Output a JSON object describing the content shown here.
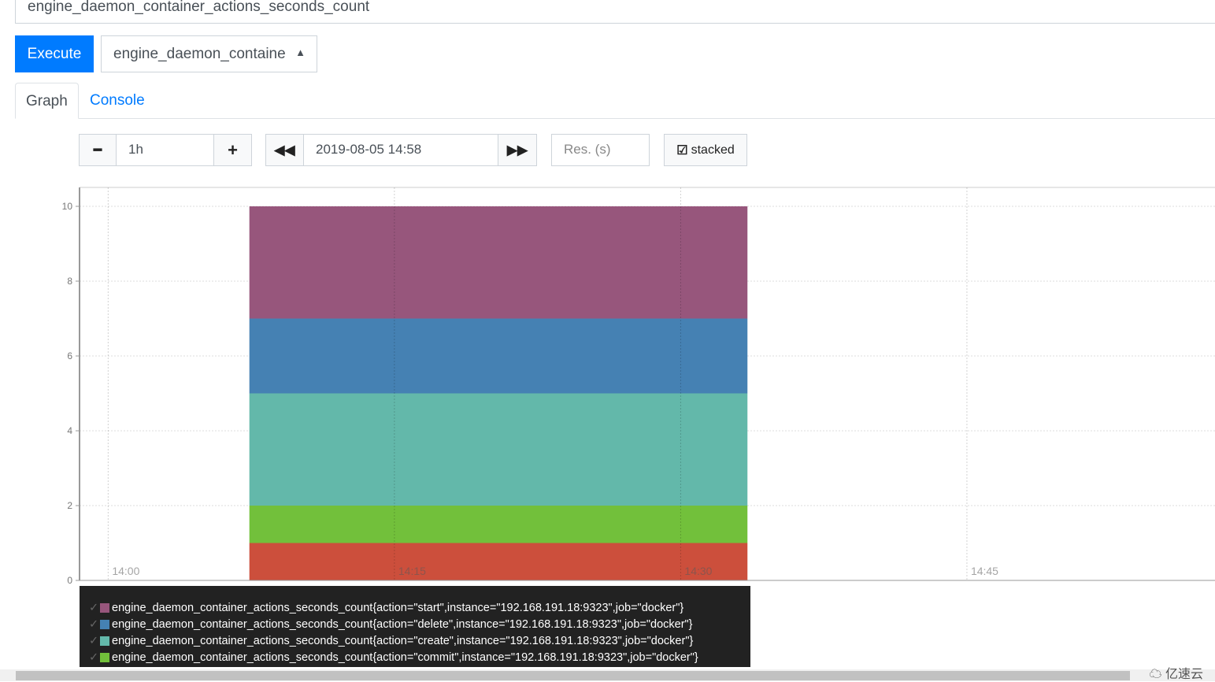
{
  "query": {
    "value": "engine_daemon_container_actions_seconds_count"
  },
  "execute_label": "Execute",
  "metric_select": {
    "selected": "engine_daemon_containe"
  },
  "tabs": [
    {
      "label": "Graph",
      "active": true
    },
    {
      "label": "Console",
      "active": false
    }
  ],
  "controls": {
    "range": "1h",
    "end_time": "2019-08-05 14:58",
    "res_placeholder": "Res. (s)",
    "stacked_label": "stacked",
    "stacked": true
  },
  "watermark": "亿速云",
  "chart_data": {
    "type": "area",
    "stacked": true,
    "x_ticks": [
      "14:00",
      "14:15",
      "14:30",
      "14:45"
    ],
    "y_ticks": [
      0,
      2,
      4,
      6,
      8,
      10
    ],
    "ylim": [
      0,
      10
    ],
    "x_range": [
      "13:58:30",
      "14:58"
    ],
    "data_start": "14:07:24",
    "data_end": "14:33:30",
    "series": [
      {
        "name": "",
        "value": 1,
        "color": "#cc4f3c"
      },
      {
        "name": "engine_daemon_container_actions_seconds_count{action=\"commit\",instance=\"192.168.191.18:9323\",job=\"docker\"}",
        "value": 1,
        "color": "#72c03b"
      },
      {
        "name": "engine_daemon_container_actions_seconds_count{action=\"create\",instance=\"192.168.191.18:9323\",job=\"docker\"}",
        "value": 3,
        "color": "#63b8aa"
      },
      {
        "name": "engine_daemon_container_actions_seconds_count{action=\"delete\",instance=\"192.168.191.18:9323\",job=\"docker\"}",
        "value": 2,
        "color": "#4581b3"
      },
      {
        "name": "engine_daemon_container_actions_seconds_count{action=\"start\",instance=\"192.168.191.18:9323\",job=\"docker\"}",
        "value": 3,
        "color": "#97567c"
      }
    ],
    "legend_order": [
      4,
      3,
      2,
      1
    ]
  }
}
